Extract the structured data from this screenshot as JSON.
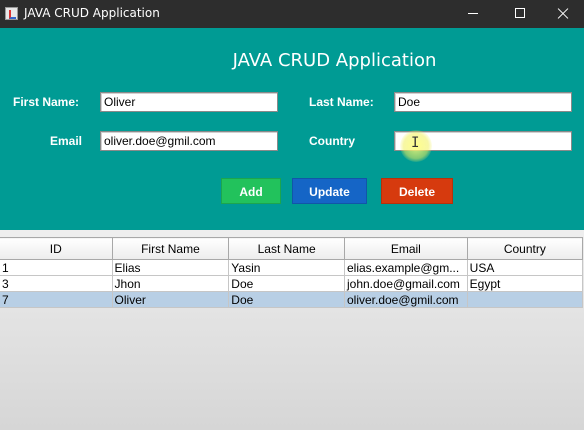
{
  "window": {
    "title": "JAVA CRUD Application",
    "controls": {
      "minimize": "minimize",
      "maximize": "maximize",
      "close": "close"
    }
  },
  "form": {
    "heading": "JAVA CRUD Application",
    "first_name_label": "First Name:",
    "first_name_value": "Oliver",
    "last_name_label": "Last Name:",
    "last_name_value": "Doe",
    "email_label": "Email",
    "email_value": "oliver.doe@gmil.com",
    "country_label": "Country",
    "country_value": "",
    "colors": {
      "panel": "#009b94",
      "add": "#22c25c",
      "update": "#1565c6",
      "delete": "#d63a0e"
    }
  },
  "actions": {
    "add": "Add",
    "update": "Update",
    "delete": "Delete"
  },
  "table": {
    "columns": [
      "ID",
      "First Name",
      "Last Name",
      "Email",
      "Country"
    ],
    "rows": [
      [
        "1",
        "Elias",
        "Yasin",
        "elias.example@gm...",
        "USA"
      ],
      [
        "3",
        "Jhon",
        "Doe",
        "john.doe@gmail.com",
        "Egypt"
      ],
      [
        "7",
        "Oliver",
        "Doe",
        "oliver.doe@gmil.com",
        ""
      ]
    ],
    "selected_row": 2
  },
  "icons": [
    "app-icon",
    "minimize-icon",
    "maximize-icon",
    "close-icon",
    "text-cursor-icon"
  ]
}
